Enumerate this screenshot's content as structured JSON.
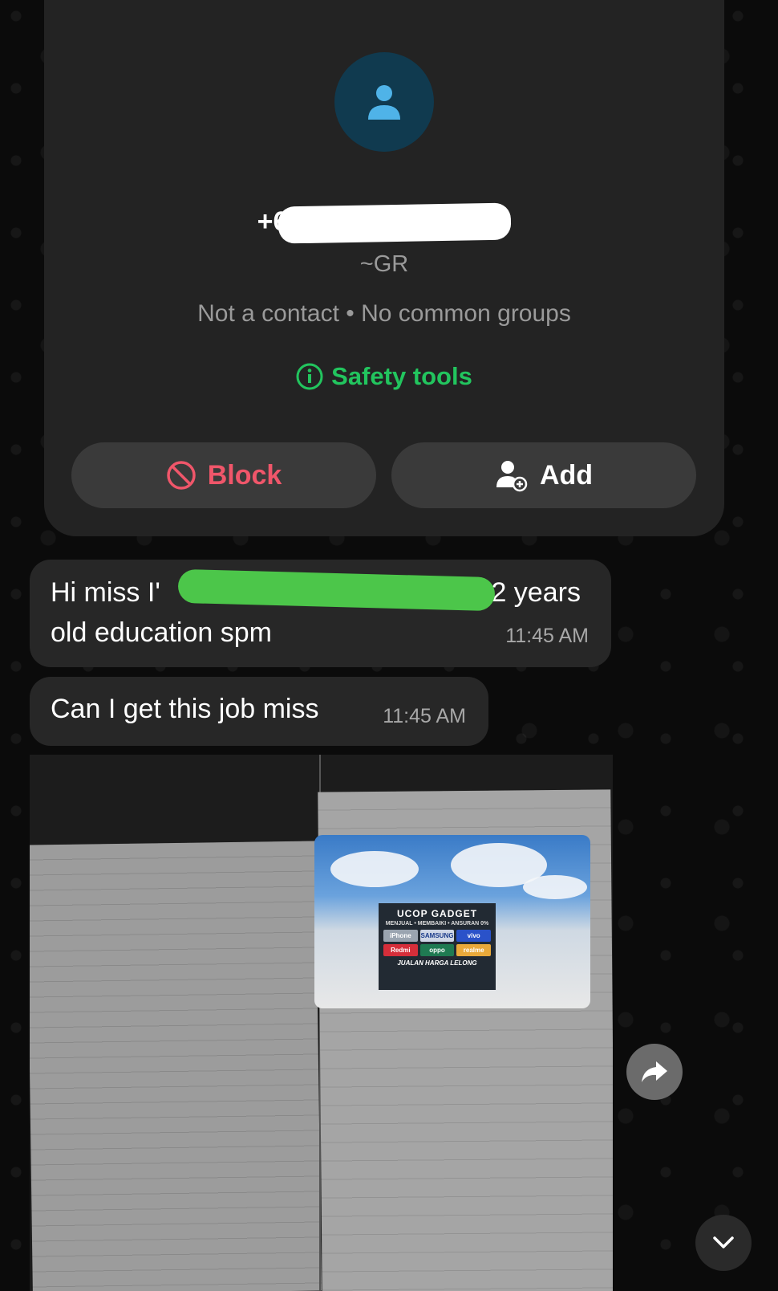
{
  "contact_card": {
    "phone_prefix": "+6",
    "push_name": "~GR",
    "subtitle": "Not a contact • No common groups",
    "safety_tools_label": "Safety tools",
    "block_label": "Block",
    "add_label": "Add"
  },
  "messages": [
    {
      "text_before": "Hi miss I'",
      "text_after": "I'm 22 years old education spm",
      "time": "11:45 AM"
    },
    {
      "text": "Can I get this job miss",
      "time": "11:45 AM"
    }
  ],
  "photo_sign": {
    "brand": "UCOP GADGET",
    "tagline": "MENJUAL • MEMBAIKI • ANSURAN 0%",
    "logos": [
      "iPhone",
      "SAMSUNG",
      "vivo",
      "Redmi",
      "oppo",
      "realme"
    ],
    "footer": "JUALAN HARGA LELONG"
  },
  "colors": {
    "accent_green": "#22c55e",
    "block_red": "#f0566a",
    "bubble": "#272727"
  }
}
